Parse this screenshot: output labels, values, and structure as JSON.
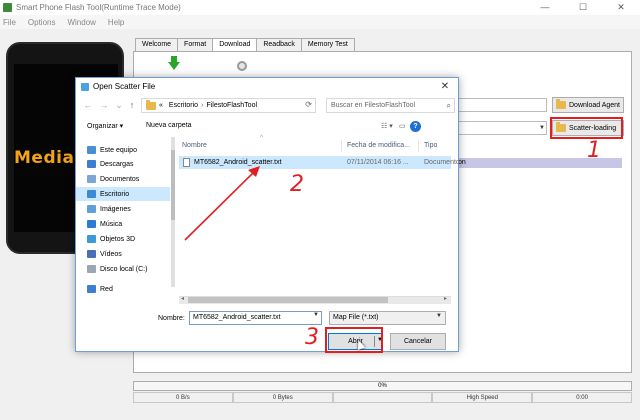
{
  "window": {
    "title": "Smart Phone Flash Tool(Runtime Trace Mode)",
    "controls": {
      "minimize": "—",
      "maximize": "☐",
      "close": "✕"
    }
  },
  "menu": [
    "File",
    "Options",
    "Window",
    "Help"
  ],
  "phone": {
    "screen_text": "Media"
  },
  "tabs": [
    "Welcome",
    "Format",
    "Download",
    "Readback",
    "Memory Test"
  ],
  "active_tab": "Download",
  "buttons": {
    "download_agent": "Download Agent",
    "scatter_loading": "Scatter-loading"
  },
  "partial_row_text": "on",
  "progress": {
    "label": "0%",
    "value": 0
  },
  "status": [
    "0 B/s",
    "0 Bytes",
    "",
    "High Speed",
    "0:00"
  ],
  "dialog": {
    "title": "Open Scatter File",
    "close": "✕",
    "address": {
      "prefix": "«",
      "path": [
        "Escritorio",
        "FilestoFlashTool"
      ]
    },
    "search_placeholder": "Buscar en FilestoFlashTool",
    "toolbar": {
      "organize": "Organizar ▾",
      "new_folder": "Nueva carpeta",
      "help": "?"
    },
    "tree": [
      {
        "label": "Este equipo",
        "color": "#4a8fd6"
      },
      {
        "label": "Descargas",
        "color": "#3d7ed1"
      },
      {
        "label": "Documentos",
        "color": "#7aa7d8"
      },
      {
        "label": "Escritorio",
        "color": "#3a8ad6",
        "selected": true
      },
      {
        "label": "Imágenes",
        "color": "#5fa0d8"
      },
      {
        "label": "Música",
        "color": "#2d7bd3"
      },
      {
        "label": "Objetos 3D",
        "color": "#3a9bd6"
      },
      {
        "label": "Vídeos",
        "color": "#4a6fb8"
      },
      {
        "label": "Disco local (C:)",
        "color": "#9aa6b3"
      },
      {
        "label": "Red",
        "color": "#3d7ed1"
      }
    ],
    "columns": [
      "Nombre",
      "Fecha de modifica...",
      "Tipo"
    ],
    "files": [
      {
        "name": "MT6582_Android_scatter.txt",
        "date": "07/11/2014 06:16 ...",
        "type": "Documento"
      }
    ],
    "name_label": "Nombre:",
    "name_value": "MT6582_Android_scatter.txt",
    "file_type": "Map File (*.txt)",
    "open_button": "Abrir",
    "cancel_button": "Cancelar"
  },
  "annotations": {
    "step1": "1",
    "step2": "2",
    "step3": "3",
    "color": "#e02020"
  }
}
